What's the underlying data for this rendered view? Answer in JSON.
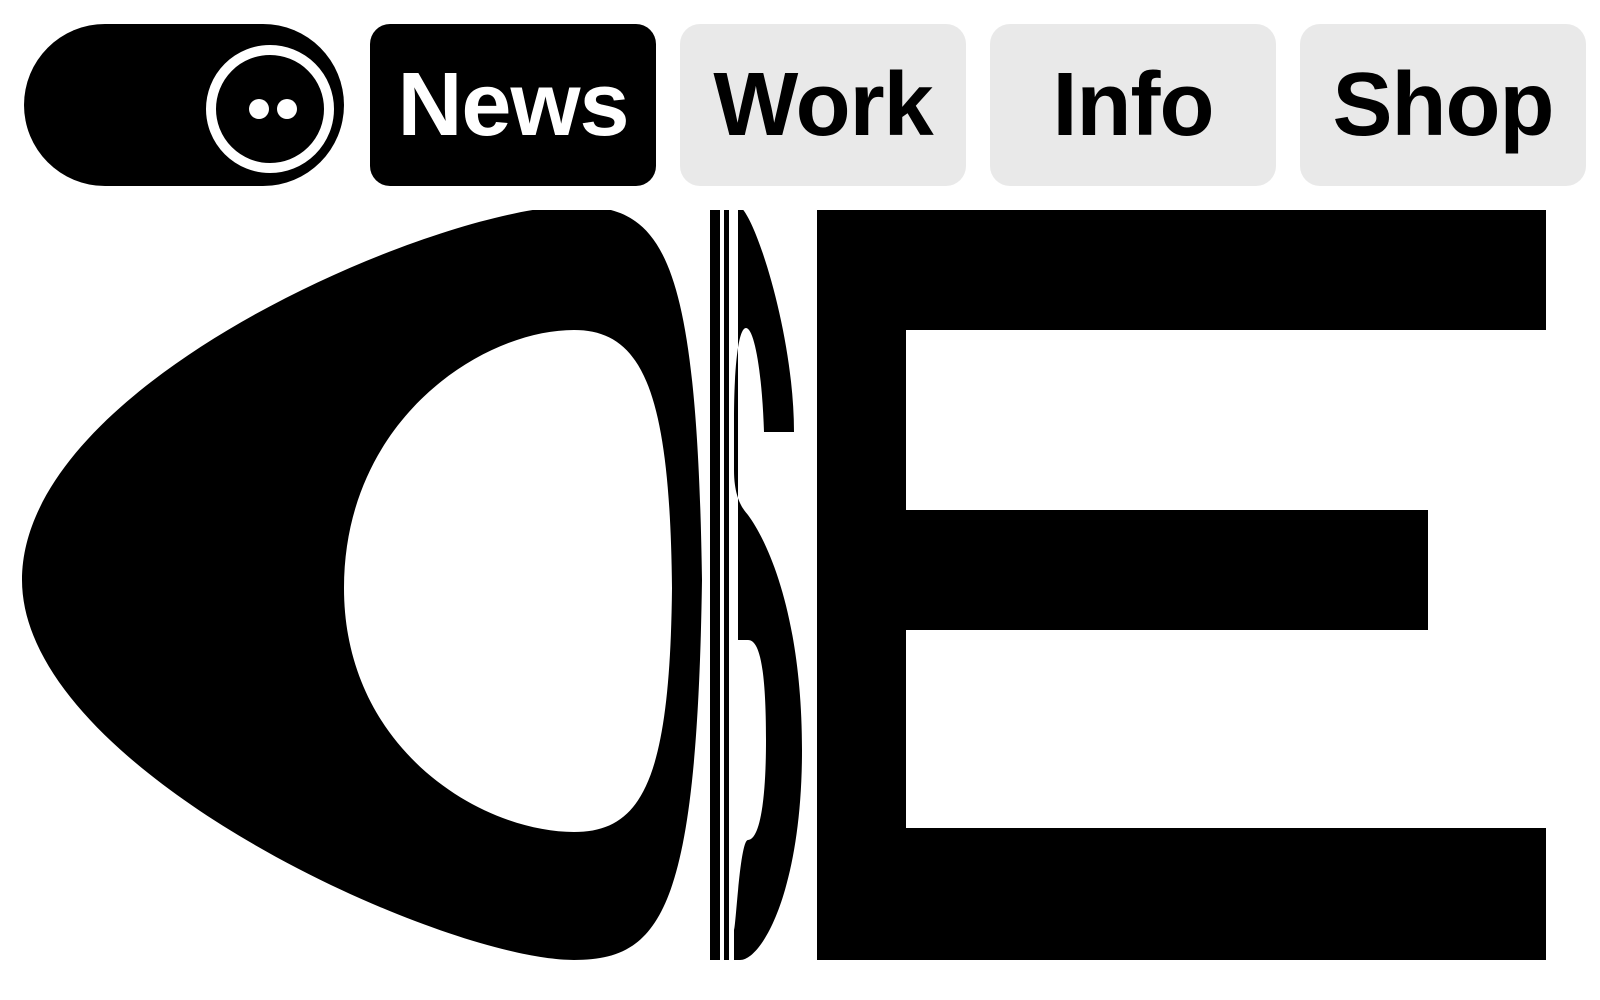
{
  "nav": {
    "toggle": {
      "icon": "smiley-face-icon",
      "state": "dark"
    },
    "tabs": [
      {
        "label": "News",
        "active": true
      },
      {
        "label": "Work",
        "active": false
      },
      {
        "label": "Info",
        "active": false
      },
      {
        "label": "Shop",
        "active": false
      }
    ]
  },
  "logo": {
    "text": "OSE",
    "color": "#000000"
  },
  "colors": {
    "tab_inactive_bg": "#e9e9e9",
    "tab_active_bg": "#000000",
    "tab_active_text": "#ffffff"
  }
}
